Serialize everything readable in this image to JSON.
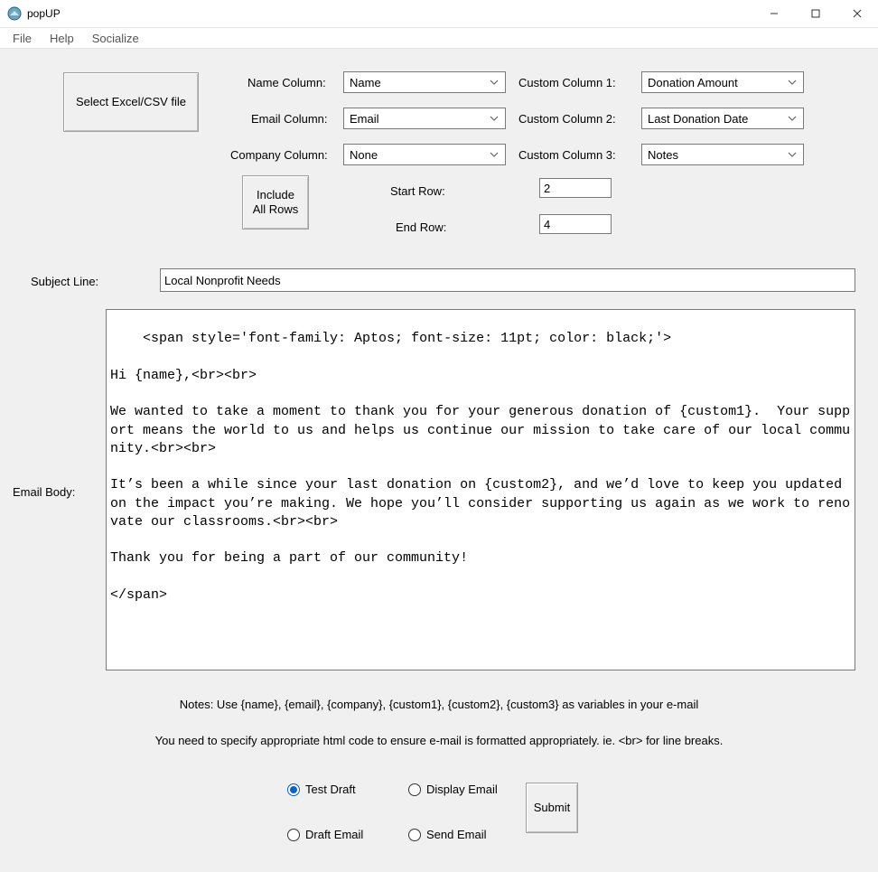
{
  "window": {
    "title": "popUP"
  },
  "menu": {
    "file": "File",
    "help": "Help",
    "socialize": "Socialize"
  },
  "buttons": {
    "select_file": "Select Excel/CSV file",
    "include_all": "Include\nAll Rows",
    "submit": "Submit"
  },
  "labels": {
    "name_col": "Name Column:",
    "email_col": "Email Column:",
    "company_col": "Company Column:",
    "custom1": "Custom Column 1:",
    "custom2": "Custom Column 2:",
    "custom3": "Custom Column 3:",
    "start_row": "Start Row:",
    "end_row": "End Row:",
    "subject": "Subject Line:",
    "body": "Email Body:",
    "notes": "Notes: Use {name}, {email}, {company}, {custom1}, {custom2}, {custom3} as variables in your e-mail",
    "notes2": "You need to specify appropriate html code to ensure e-mail is formatted appropriately. ie. <br> for line breaks."
  },
  "combos": {
    "name": "Name",
    "email": "Email",
    "company": "None",
    "custom1": "Donation Amount",
    "custom2": "Last Donation Date",
    "custom3": "Notes"
  },
  "inputs": {
    "start_row": "2",
    "end_row": "4",
    "subject": "Local Nonprofit Needs"
  },
  "body_text": "<span style='font-family: Aptos; font-size: 11pt; color: black;'>\n\nHi {name},<br><br>\n\nWe wanted to take a moment to thank you for your generous donation of {custom1}.  Your support means the world to us and helps us continue our mission to take care of our local community.<br><br>\n\nIt’s been a while since your last donation on {custom2}, and we’d love to keep you updated on the impact you’re making. We hope you’ll consider supporting us again as we work to renovate our classrooms.<br><br>\n\nThank you for being a part of our community!\n\n</span>",
  "radios": {
    "test_draft": "Test Draft",
    "display_email": "Display Email",
    "draft_email": "Draft Email",
    "send_email": "Send Email",
    "selected": "test_draft"
  }
}
